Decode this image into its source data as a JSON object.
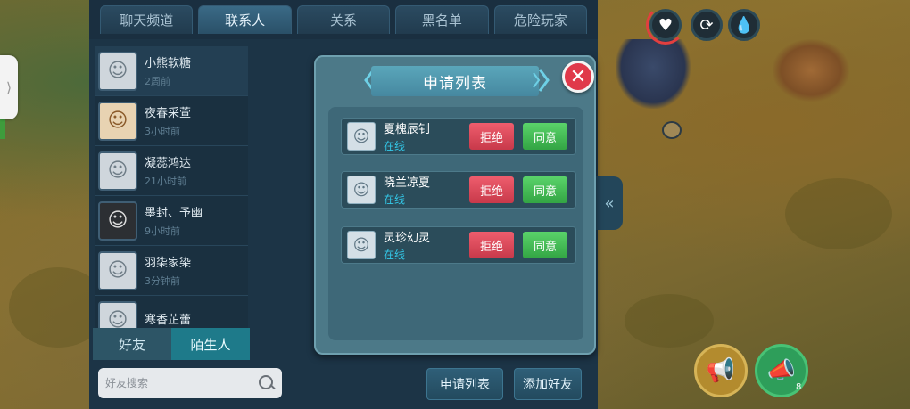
{
  "tabs": [
    "聊天频道",
    "联系人",
    "关系",
    "黑名单",
    "危险玩家"
  ],
  "contacts": [
    {
      "name": "小熊软糖",
      "time": "2周前"
    },
    {
      "name": "夜春采萱",
      "time": "3小时前"
    },
    {
      "name": "凝蕊鸿达",
      "time": "21小时前"
    },
    {
      "name": "墨封、予幽",
      "time": "9小时前"
    },
    {
      "name": "羽柒家染",
      "time": "3分钟前"
    },
    {
      "name": "寒香芷蕾",
      "time": ""
    }
  ],
  "sub_tabs": {
    "friends": "好友",
    "strangers": "陌生人"
  },
  "search": {
    "placeholder": "好友搜索"
  },
  "bottom_buttons": {
    "apply_list": "申请列表",
    "add_friend": "添加好友"
  },
  "modal": {
    "title": "申请列表",
    "close_icon": "close-icon",
    "requests": [
      {
        "name": "夏槐辰钊",
        "status": "在线",
        "reject": "拒绝",
        "accept": "同意"
      },
      {
        "name": "晓兰凉夏",
        "status": "在线",
        "reject": "拒绝",
        "accept": "同意"
      },
      {
        "name": "灵珍幻灵",
        "status": "在线",
        "reject": "拒绝",
        "accept": "同意"
      }
    ]
  },
  "hud": {
    "horn_count": "8"
  },
  "colors": {
    "reject": "#d9434f",
    "accept": "#3fb550",
    "online": "#33c8e8",
    "close": "#e0394a"
  }
}
